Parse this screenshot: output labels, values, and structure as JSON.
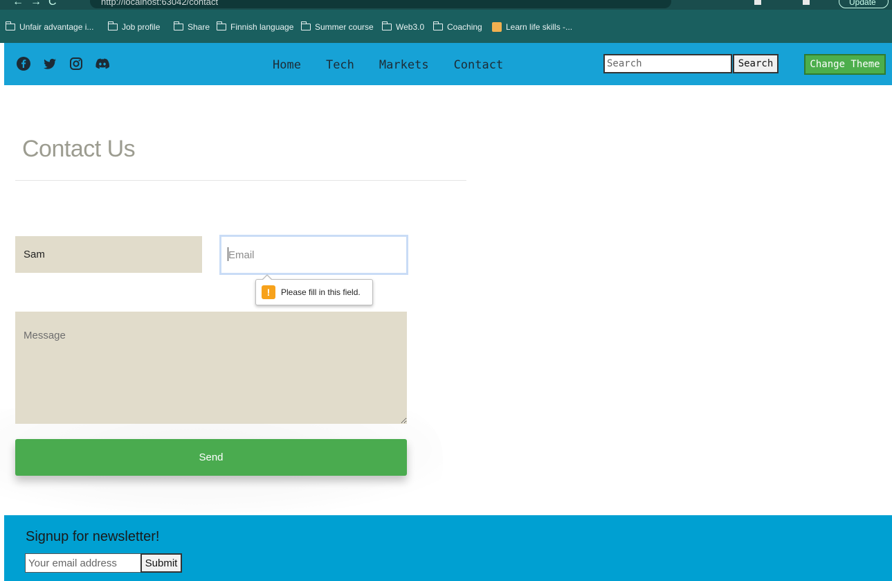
{
  "browser": {
    "url": "http://localhost:63042/contact",
    "update_label": "Update",
    "bookmarks": [
      {
        "label": "Unfair advantage i...",
        "icon": "folder-icon"
      },
      {
        "label": "Job profile",
        "icon": "folder-icon"
      },
      {
        "label": "Share",
        "icon": "folder-icon"
      },
      {
        "label": "Finnish language",
        "icon": "folder-icon"
      },
      {
        "label": "Summer course",
        "icon": "folder-icon"
      },
      {
        "label": "Web3.0",
        "icon": "folder-icon"
      },
      {
        "label": "Coaching",
        "icon": "folder-icon"
      },
      {
        "label": "Learn life skills -...",
        "icon": "favicon"
      }
    ]
  },
  "header": {
    "social": [
      "facebook-icon",
      "twitter-icon",
      "instagram-icon",
      "discord-icon"
    ],
    "nav": [
      "Home",
      "Tech",
      "Markets",
      "Contact"
    ],
    "search_placeholder": "Search",
    "search_button": "Search",
    "theme_button": "Change Theme"
  },
  "contact": {
    "title": "Contact Us",
    "name_value": "Sam",
    "email_placeholder": "Email",
    "tooltip": "Please fill in this field.",
    "message_placeholder": "Message",
    "send_label": "Send"
  },
  "footer": {
    "title": "Signup for newsletter!",
    "email_placeholder": "Your email address",
    "submit_label": "Submit"
  },
  "colors": {
    "header_bg": "#17a2d6",
    "footer_bg": "#00a0d2",
    "field_bg": "#e1dccb",
    "send_bg": "#4aab4f",
    "theme_btn_bg": "#4cae4c",
    "title_color": "#9c9c90"
  }
}
